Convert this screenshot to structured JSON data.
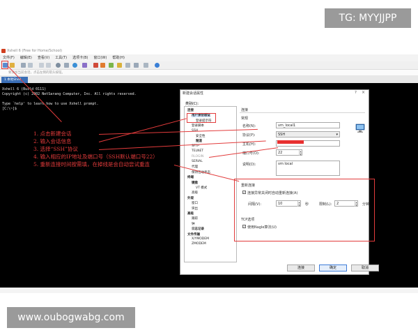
{
  "watermarks": {
    "top": "TG: MYYJJPP",
    "bottom": "www.oubogwabg.com"
  },
  "app": {
    "title": "Xshell 6 (Free for Home/School)",
    "menu": [
      "文件(F)",
      "编辑(E)",
      "查看(V)",
      "工具(T)",
      "选项卡(B)",
      "窗口(W)",
      "帮助(H)"
    ],
    "address_placeholder": "要添加当前会话，点击左侧的箭头按钮。",
    "tab_label": "1 本地Shell"
  },
  "terminal": {
    "lines": [
      "Xshell 6 (Build 0111)",
      "Copyright (c) 2002 NetSarang Computer, Inc. All rights reserved.",
      "",
      "Type `help' to learn how to use Xshell prompt.",
      "[C:\\~]$ "
    ]
  },
  "annotations": [
    "1. 点击新建会话",
    "2. 输入会话信息",
    "3. 选择“SSH”协议",
    "4. 输入相应的IP地址及端口号（SSH默认端口号22）",
    "5. 重新连接时间按需填，在掉线是会自动尝试重连"
  ],
  "dialog": {
    "title": "新建会话属性",
    "help": "?",
    "close": "×",
    "category_label": "类别(C):",
    "tree": [
      {
        "label": "连接",
        "bold": true
      },
      {
        "label": "用户身份验证",
        "bold": true,
        "selected": true
      },
      {
        "label": "登录提示符"
      },
      {
        "label": "登录脚本"
      },
      {
        "label": "SSH"
      },
      {
        "label": "安全性"
      },
      {
        "label": "隧道",
        "bold": true
      },
      {
        "label": "SFTP"
      },
      {
        "label": "TELNET"
      },
      {
        "label": "RLOGIN",
        "muted": true
      },
      {
        "label": "SERIAL"
      },
      {
        "label": "代理"
      },
      {
        "label": "保持活动状态"
      },
      {
        "label": "终端",
        "bold": true
      },
      {
        "label": "键盘",
        "bold": true
      },
      {
        "label": "VT 模式"
      },
      {
        "label": "高级"
      },
      {
        "label": "外观",
        "bold": true
      },
      {
        "label": "窗口"
      },
      {
        "label": "突出"
      },
      {
        "label": "高级",
        "bold": true
      },
      {
        "label": "跟踪"
      },
      {
        "label": "钟"
      },
      {
        "label": "日志记录",
        "bold": true
      },
      {
        "label": "文件传输",
        "bold": true
      },
      {
        "label": "X/YMODEM"
      },
      {
        "label": "ZMODEM"
      }
    ],
    "section_connect": "连接",
    "section_general": "常规",
    "name_label": "名称(N):",
    "name_value": "vm_local1",
    "protocol_label": "协议(P):",
    "protocol_value": "SSH",
    "host_label": "主机(H):",
    "port_label": "端口号(O):",
    "port_value": "22",
    "desc_label": "说明(D):",
    "desc_value": "vm local",
    "reconnect_title": "重新连接",
    "reconnect_check": "连接异常关闭时自动重新连接(A)",
    "interval_label": "间隔(V):",
    "interval_value": "10",
    "interval_unit": "秒",
    "limit_label": "限制(L):",
    "limit_value": "2",
    "limit_unit": "分钟",
    "tcp_title": "TCP选项",
    "nagle_check": "使用Nagle算法(U)",
    "check_mark": "✓",
    "spin_up": "▲",
    "spin_down": "▼",
    "select_arrow": "▾",
    "buttons": {
      "connect": "连接",
      "ok": "确定",
      "cancel": "取消"
    }
  },
  "colors": {
    "annotation": "#e23b3b",
    "terminal_bg": "#000000",
    "accent": "#3b6fb6"
  }
}
